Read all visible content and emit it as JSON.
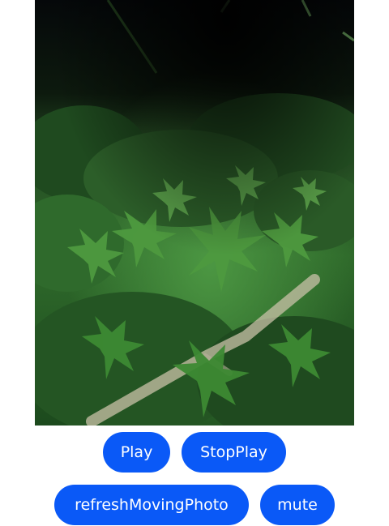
{
  "colors": {
    "accent": "#0a59f7",
    "button_text": "#ffffff",
    "background": "#ffffff"
  },
  "photo": {
    "description_name": "moving-photo"
  },
  "controls": {
    "play_label": "Play",
    "stop_label": "StopPlay",
    "refresh_label": "refreshMovingPhoto",
    "mute_label": "mute"
  }
}
